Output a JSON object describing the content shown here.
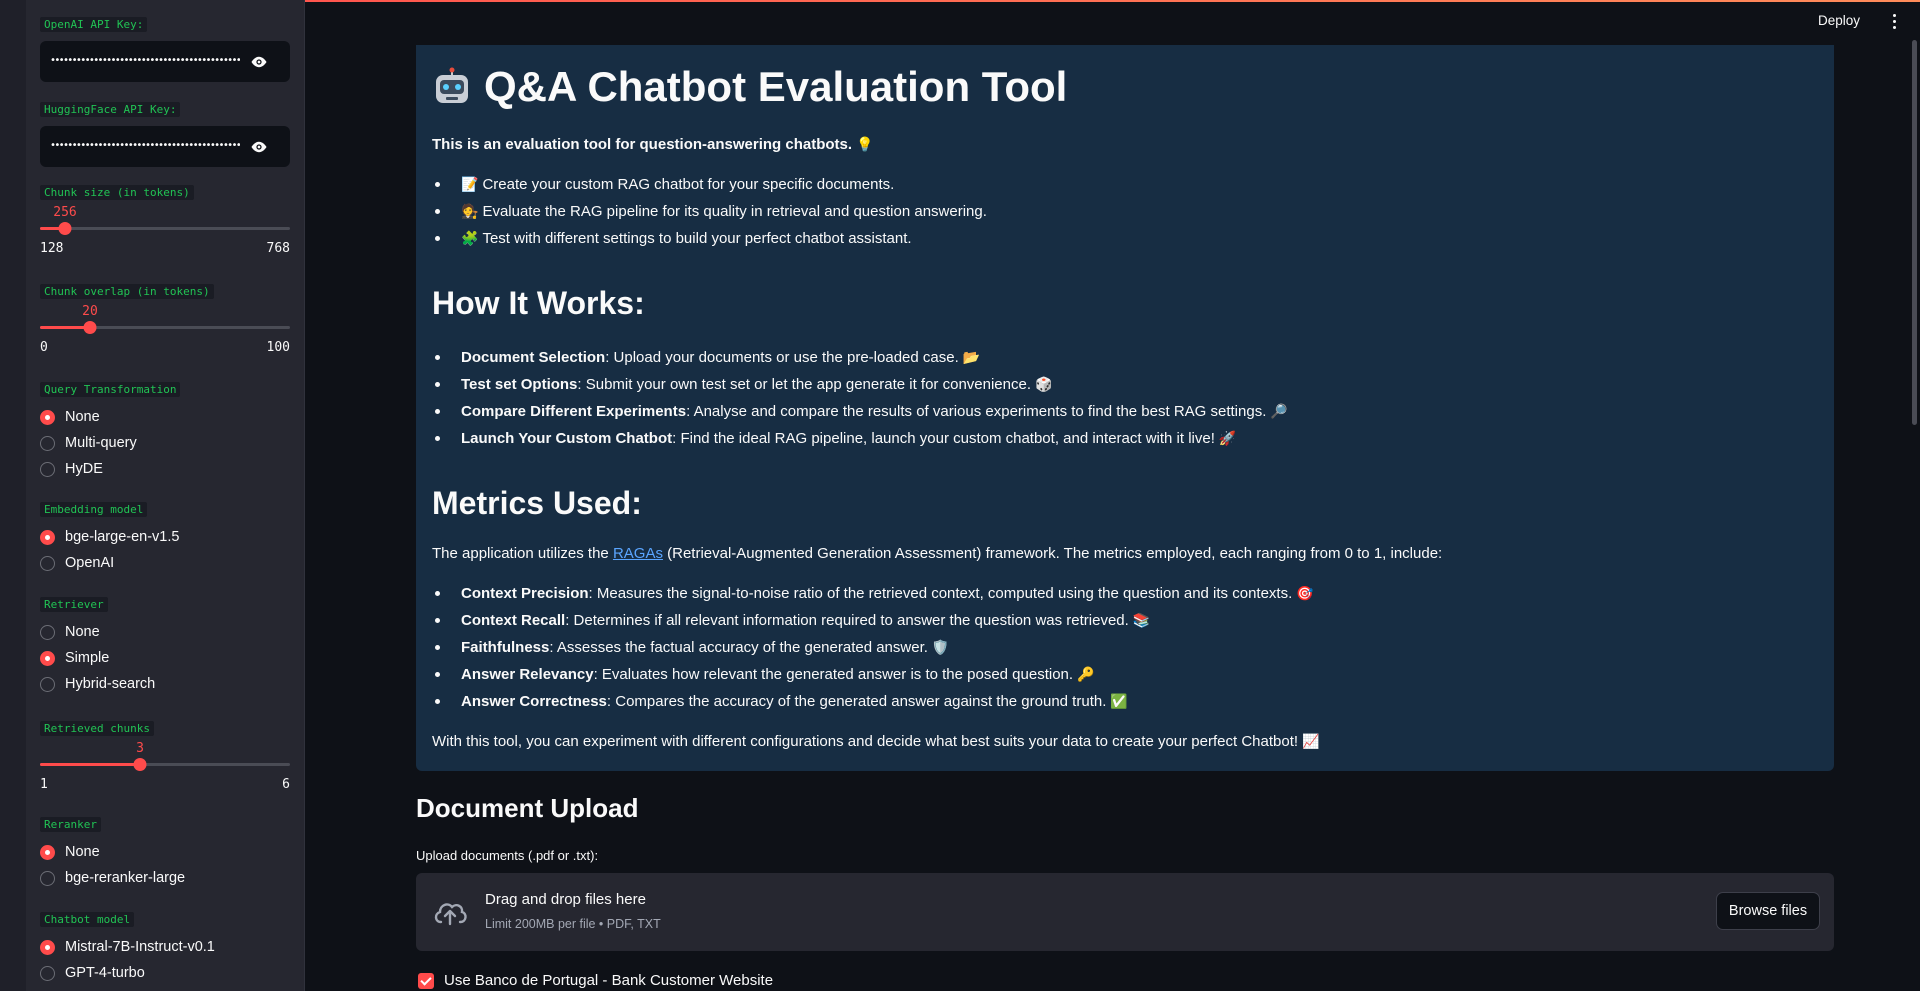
{
  "header": {
    "deploy_label": "Deploy"
  },
  "sidebar": {
    "openai_key": {
      "label": "OpenAI API Key:",
      "value": "••••••••••••••••••••••••••••••••••••••••••••••••••••"
    },
    "hf_key": {
      "label": "HuggingFace API Key:",
      "value": "•••••••••••••••••••••••••••••••••••••••••••••••••"
    },
    "chunk_size": {
      "label": "Chunk size (in tokens)",
      "value": "256",
      "min": "128",
      "max": "768",
      "fraction": 0.1
    },
    "chunk_overlap": {
      "label": "Chunk overlap (in tokens)",
      "value": "20",
      "min": "0",
      "max": "100",
      "fraction": 0.2
    },
    "query_transformation": {
      "label": "Query Transformation",
      "options": [
        "None",
        "Multi-query",
        "HyDE"
      ],
      "selected": 0
    },
    "embedding_model": {
      "label": "Embedding model",
      "options": [
        "bge-large-en-v1.5",
        "OpenAI"
      ],
      "selected": 0
    },
    "retriever": {
      "label": "Retriever",
      "options": [
        "None",
        "Simple",
        "Hybrid-search"
      ],
      "selected": 1
    },
    "retrieved_chunks": {
      "label": "Retrieved chunks",
      "value": "3",
      "min": "1",
      "max": "6",
      "fraction": 0.4
    },
    "reranker": {
      "label": "Reranker",
      "options": [
        "None",
        "bge-reranker-large"
      ],
      "selected": 0
    },
    "chatbot_model": {
      "label": "Chatbot model",
      "options": [
        "Mistral-7B-Instruct-v0.1",
        "GPT-4-turbo"
      ],
      "selected": 0
    }
  },
  "intro": {
    "title": "Q&A Chatbot Evaluation Tool",
    "subtitle": "This is an evaluation tool for question-answering chatbots.",
    "bullets": [
      "Create your custom RAG chatbot for your specific documents.",
      "Evaluate the RAG pipeline for its quality in retrieval and question answering.",
      "Test with different settings to build your perfect chatbot assistant."
    ]
  },
  "how": {
    "title": "How It Works:",
    "items": [
      {
        "bold": "Document Selection",
        "text": ": Upload your documents or use the pre-loaded case."
      },
      {
        "bold": "Test set Options",
        "text": ": Submit your own test set or let the app generate it for convenience."
      },
      {
        "bold": "Compare Different Experiments",
        "text": ": Analyse and compare the results of various experiments to find the best RAG settings."
      },
      {
        "bold": "Launch Your Custom Chatbot",
        "text": ": Find the ideal RAG pipeline, launch your custom chatbot, and interact with it live!"
      }
    ]
  },
  "metrics": {
    "title": "Metrics Used:",
    "intro_before": "The application utilizes the ",
    "intro_link": "RAGAs",
    "intro_after": " (Retrieval-Augmented Generation Assessment) framework. The metrics employed, each ranging from 0 to 1, include:",
    "items": [
      {
        "bold": "Context Precision",
        "text": ": Measures the signal-to-noise ratio of the retrieved context, computed using the question and its contexts."
      },
      {
        "bold": "Context Recall",
        "text": ": Determines if all relevant information required to answer the question was retrieved."
      },
      {
        "bold": "Faithfulness",
        "text": ": Assesses the factual accuracy of the generated answer."
      },
      {
        "bold": "Answer Relevancy",
        "text": ": Evaluates how relevant the generated answer is to the posed question."
      },
      {
        "bold": "Answer Correctness",
        "text": ": Compares the accuracy of the generated answer against the ground truth."
      }
    ],
    "closing": "With this tool, you can experiment with different configurations and decide what best suits your data to create your perfect Chatbot!"
  },
  "upload": {
    "title": "Document Upload",
    "label": "Upload documents (.pdf or .txt):",
    "drop_title": "Drag and drop files here",
    "drop_sub": "Limit 200MB per file • PDF, TXT",
    "browse_label": "Browse files",
    "checkbox_label": "Use Banco de Portugal - Bank Customer Website"
  }
}
